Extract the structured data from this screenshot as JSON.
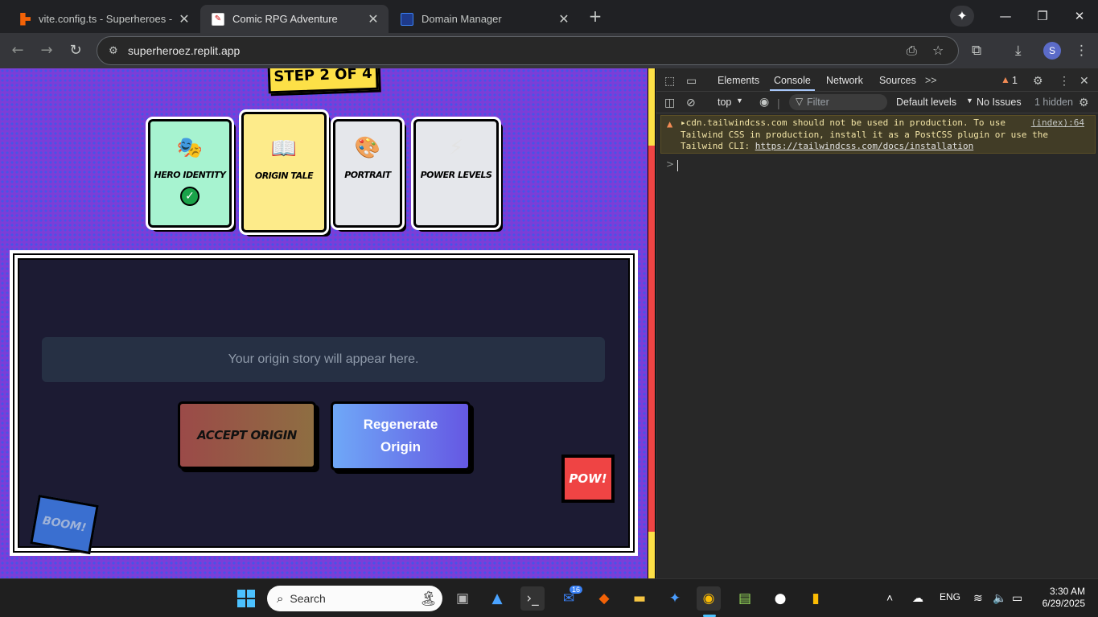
{
  "browser": {
    "tabs": [
      {
        "title": "vite.config.ts - Superheroes - Re",
        "favicon": "replit-icon",
        "active": false
      },
      {
        "title": "Comic RPG Adventure",
        "favicon": "comic-icon",
        "active": true
      },
      {
        "title": "Domain Manager",
        "favicon": "domain-icon",
        "active": false
      }
    ],
    "new_tab": "+",
    "url": "superheroez.replit.app",
    "profile_initial": "S"
  },
  "page": {
    "step_label": "STEP 2 OF 4",
    "steps": [
      {
        "label": "HERO IDENTITY",
        "emoji": "🎭",
        "state": "completed",
        "check": "✓",
        "bg": "#a7f3d0"
      },
      {
        "label": "ORIGIN TALE",
        "emoji": "📖",
        "state": "current",
        "bg": "#fdeb8a"
      },
      {
        "label": "PORTRAIT",
        "emoji": "🎨",
        "state": "pending",
        "bg": "#e5e7eb"
      },
      {
        "label": "POWER LEVELS",
        "emoji": "⚡",
        "state": "pending",
        "bg": "#e5e7eb"
      }
    ],
    "story_placeholder": "Your origin story will appear here.",
    "accept_button": "ACCEPT ORIGIN",
    "regenerate_button": "Regenerate Origin",
    "pow_label": "POW!",
    "boom_label": "BOOM!"
  },
  "devtools": {
    "tabs": [
      "Elements",
      "Console",
      "Network",
      "Sources"
    ],
    "active_tab": "Console",
    "more": ">>",
    "issue_count": "1",
    "context": "top",
    "filter_placeholder": "Filter",
    "levels": "Default levels",
    "issues": "No Issues",
    "hidden": "1 hidden",
    "warning": {
      "line1": "cdn.tailwindcss.com should not be used in production. To use",
      "line2": "Tailwind CSS in production, install it as a PostCSS plugin or use the",
      "line3_prefix": "Tailwind CLI: ",
      "link": "https://tailwindcss.com/docs/installation",
      "source": "(index):64"
    },
    "prompt": ">"
  },
  "taskbar": {
    "search_placeholder": "Search",
    "badge": "16",
    "language": "ENG",
    "time": "3:30 AM",
    "date": "6/29/2025"
  }
}
